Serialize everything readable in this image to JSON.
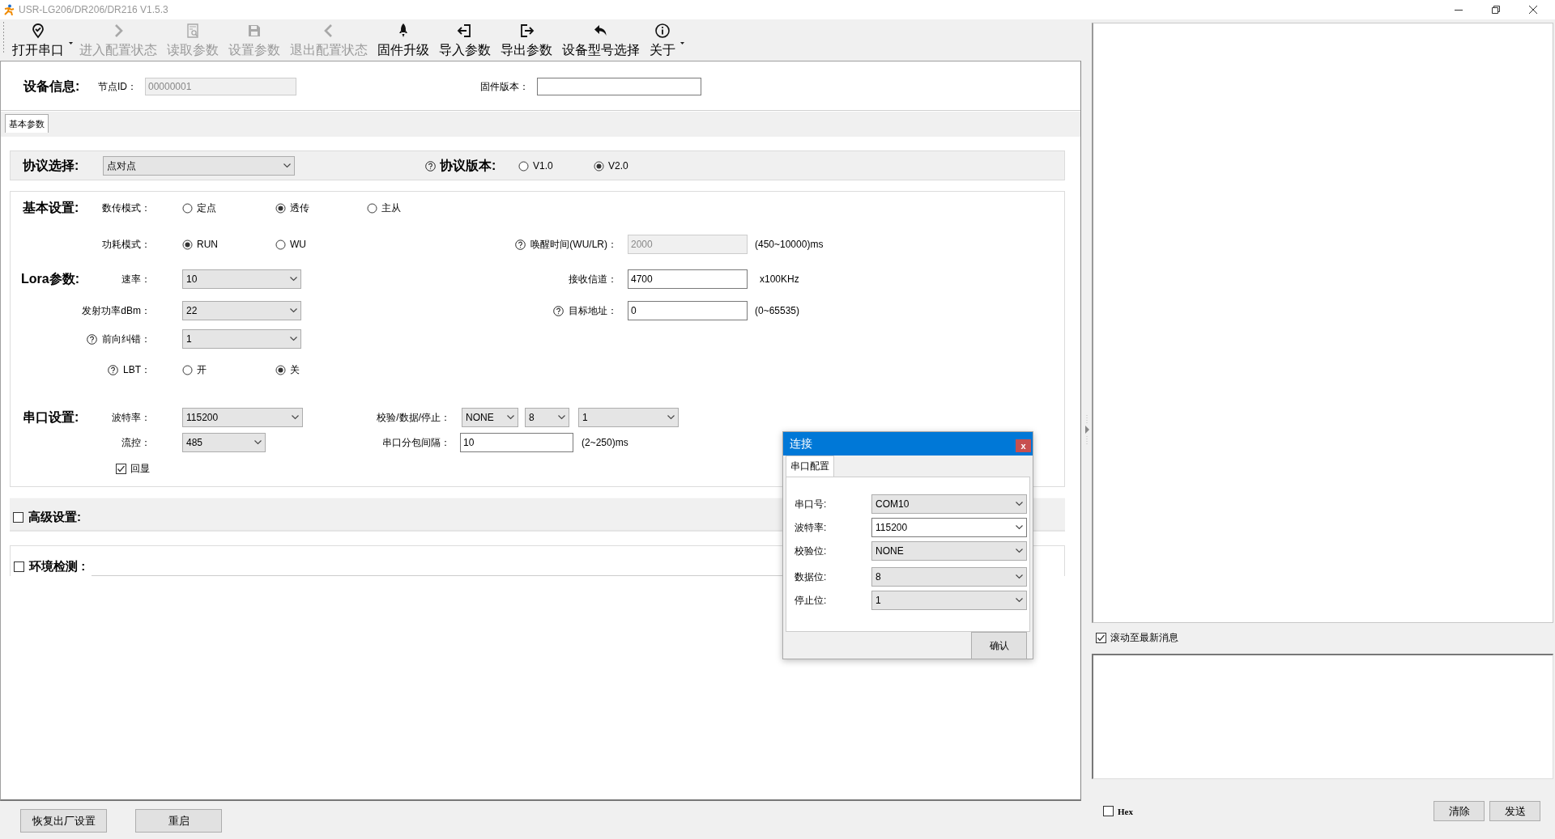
{
  "window": {
    "title": "USR-LG206/DR206/DR216 V1.5.3"
  },
  "toolbar": [
    {
      "label": "打开串口",
      "disabled": false,
      "menu": true
    },
    {
      "label": "进入配置状态",
      "disabled": true,
      "menu": false
    },
    {
      "label": "读取参数",
      "disabled": true,
      "menu": false
    },
    {
      "label": "设置参数",
      "disabled": true,
      "menu": false
    },
    {
      "label": "退出配置状态",
      "disabled": true,
      "menu": false
    },
    {
      "label": "固件升级",
      "disabled": false,
      "menu": false
    },
    {
      "label": "导入参数",
      "disabled": false,
      "menu": false
    },
    {
      "label": "导出参数",
      "disabled": false,
      "menu": false
    },
    {
      "label": "设备型号选择",
      "disabled": false,
      "menu": false
    },
    {
      "label": "关于",
      "disabled": false,
      "menu": true
    }
  ],
  "device_info": {
    "title": "设备信息:",
    "fields": [
      {
        "label": "节点ID：",
        "value": "00000001",
        "disabled": true
      },
      {
        "label": "固件版本：",
        "disabled": false
      }
    ]
  },
  "tabs": [
    {
      "label": "基本参数",
      "selected": true
    }
  ],
  "sections": [
    {
      "kind": "bar",
      "rows": [
        {
          "left": [
            {
              "kind": "title",
              "text": "协议选择:",
              "help": false
            },
            {
              "kind": "select",
              "value": "点对点"
            }
          ],
          "right": [
            {
              "kind": "title",
              "text": "协议版本:",
              "help": true
            },
            {
              "kind": "radio",
              "label": "V1.0",
              "selected": false
            },
            {
              "kind": "radio",
              "label": "V2.0",
              "selected": true
            }
          ]
        }
      ]
    },
    {
      "kind": "box",
      "rows": [
        {
          "left": [
            {
              "kind": "title",
              "text": "基本设置:",
              "help": false
            },
            {
              "kind": "label",
              "text": "数传模式：",
              "help": false
            },
            {
              "kind": "radio",
              "label": "定点",
              "selected": false
            },
            {
              "kind": "radio",
              "label": "透传",
              "selected": true
            },
            {
              "kind": "radio",
              "label": "主从",
              "selected": false
            }
          ]
        },
        {
          "left": [
            {
              "kind": "label",
              "text": "功耗模式：",
              "help": false
            },
            {
              "kind": "radio",
              "label": "RUN",
              "selected": true
            },
            {
              "kind": "radio",
              "label": "WU",
              "selected": false
            }
          ],
          "right": [
            {
              "kind": "label",
              "text": "唤醒时间(WU/LR)：",
              "help": true
            },
            {
              "kind": "input",
              "value": "2000",
              "disabled": true
            },
            {
              "kind": "note",
              "text": "(450~10000)ms"
            }
          ]
        },
        {
          "left": [
            {
              "kind": "title",
              "text": "Lora参数:",
              "help": false
            },
            {
              "kind": "label",
              "text": "速率：",
              "help": false
            },
            {
              "kind": "select",
              "value": "10"
            }
          ],
          "right": [
            {
              "kind": "label",
              "text": "接收信道：",
              "help": false
            },
            {
              "kind": "input",
              "value": "4700",
              "disabled": false
            },
            {
              "kind": "note",
              "text": "x100KHz"
            }
          ]
        },
        {
          "left": [
            {
              "kind": "label",
              "text": "发射功率dBm：",
              "help": false
            },
            {
              "kind": "select",
              "value": "22"
            }
          ],
          "right": [
            {
              "kind": "label",
              "text": "目标地址：",
              "help": true
            },
            {
              "kind": "input",
              "value": "0",
              "disabled": false
            },
            {
              "kind": "note",
              "text": "(0~65535)"
            }
          ]
        },
        {
          "left": [
            {
              "kind": "label",
              "text": "前向纠错：",
              "help": true
            },
            {
              "kind": "select",
              "value": "1"
            }
          ]
        },
        {
          "left": [
            {
              "kind": "label",
              "text": "LBT：",
              "help": true
            },
            {
              "kind": "radio",
              "label": "开",
              "selected": false
            },
            {
              "kind": "radio",
              "label": "关",
              "selected": true
            }
          ]
        },
        {
          "left": [
            {
              "kind": "title",
              "text": "串口设置:",
              "help": false
            },
            {
              "kind": "label",
              "text": "波特率：",
              "help": false
            },
            {
              "kind": "select",
              "value": "115200"
            }
          ],
          "right": [
            {
              "kind": "label",
              "text": "校验/数据/停止：",
              "help": false
            },
            {
              "kind": "select",
              "value": "NONE"
            },
            {
              "kind": "select",
              "value": "8"
            },
            {
              "kind": "select",
              "value": "1"
            }
          ]
        },
        {
          "left": [
            {
              "kind": "label",
              "text": "流控：",
              "help": false
            },
            {
              "kind": "select",
              "value": "485"
            }
          ],
          "right": [
            {
              "kind": "label",
              "text": "串口分包间隔：",
              "help": false
            },
            {
              "kind": "input",
              "value": "10",
              "disabled": false
            },
            {
              "kind": "note",
              "text": "(2~250)ms"
            }
          ]
        },
        {
          "left": [
            {
              "kind": "check",
              "label": "回显",
              "checked": true
            }
          ]
        }
      ]
    },
    {
      "kind": "toggle-bar",
      "label": "高级设置:",
      "checked": false
    },
    {
      "kind": "toggle-line",
      "label": "环境检测 :",
      "checked": false
    }
  ],
  "bottom_buttons": [
    "恢复出厂设置",
    "重启"
  ],
  "log": {
    "scroll_latest": {
      "label": "滚动至最新消息",
      "checked": true
    }
  },
  "send": {
    "hex": {
      "label": "Hex",
      "checked": false
    },
    "buttons": [
      "清除",
      "发送"
    ]
  },
  "dialog": {
    "title": "连接",
    "close": "x",
    "tabs": [
      {
        "label": "串口配置",
        "selected": true
      }
    ],
    "fields": [
      {
        "label": "串口号:",
        "value": "COM10",
        "editable": false
      },
      {
        "label": "波特率:",
        "value": "115200",
        "editable": true
      },
      {
        "label": "校验位:",
        "value": "NONE",
        "editable": false
      },
      {
        "label": "数据位:",
        "value": "8",
        "editable": false
      },
      {
        "label": "停止位:",
        "value": "1",
        "editable": false
      }
    ],
    "confirm": "确认"
  }
}
